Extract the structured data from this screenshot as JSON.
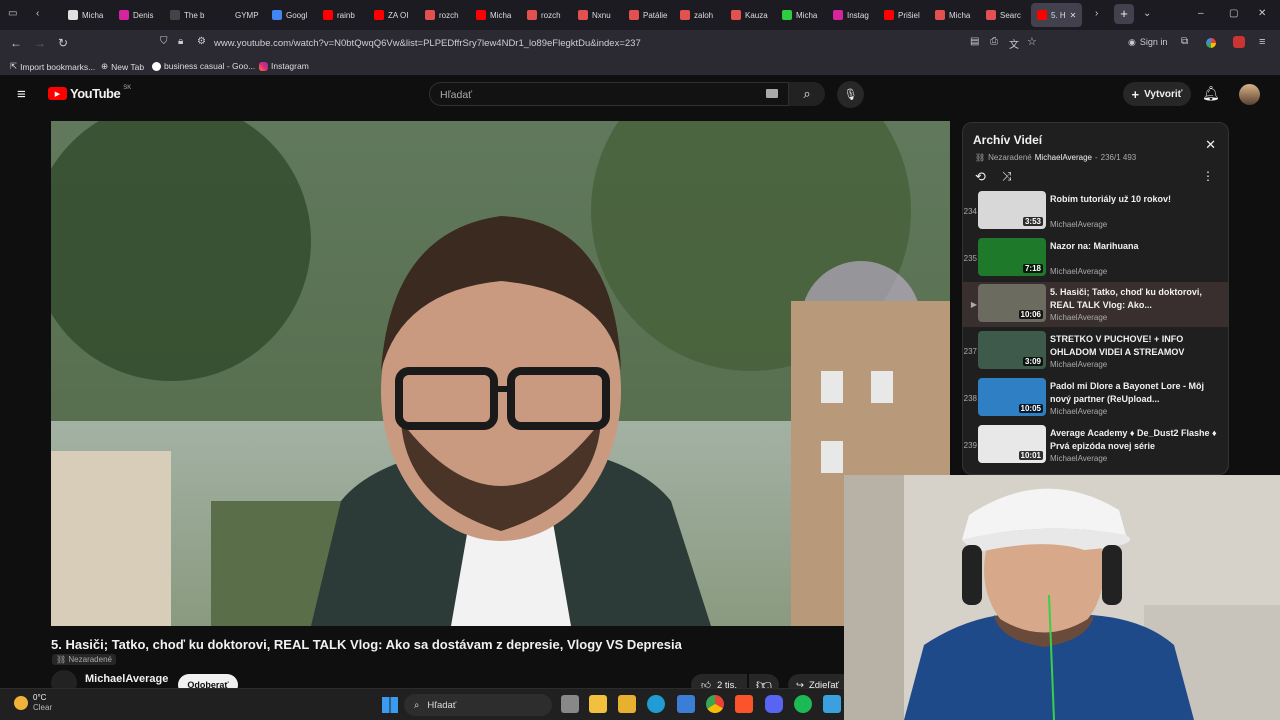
{
  "browser": {
    "tabs": [
      {
        "label": "Micha",
        "color": "#e0e0e0"
      },
      {
        "label": "Denis",
        "color": "#d6249f"
      },
      {
        "label": "The b",
        "color": "#444444"
      },
      {
        "label": "GYMP",
        "color": "#1c1b22"
      },
      {
        "label": "Googl",
        "color": "#4285f4"
      },
      {
        "label": "rainb",
        "color": "#ff0000"
      },
      {
        "label": "ZA OI",
        "color": "#ff0000"
      },
      {
        "label": "rozch",
        "color": "#e25050"
      },
      {
        "label": "Micha",
        "color": "#ff0000"
      },
      {
        "label": "rozch",
        "color": "#e25050"
      },
      {
        "label": "Nxnu",
        "color": "#e25050"
      },
      {
        "label": "Patálie",
        "color": "#e25050"
      },
      {
        "label": "zaloh",
        "color": "#e25050"
      },
      {
        "label": "Kauza",
        "color": "#e25050"
      },
      {
        "label": "Micha",
        "color": "#2ecc40"
      },
      {
        "label": "Instag",
        "color": "#d6249f"
      },
      {
        "label": "Prišiel",
        "color": "#ff0000"
      },
      {
        "label": "Micha",
        "color": "#e25050"
      },
      {
        "label": "Searc",
        "color": "#e25050"
      },
      {
        "label": "5. H",
        "color": "#ff0000"
      }
    ],
    "url": "www.youtube.com/watch?v=N0btQwqQ6Vw&list=PLPEDffrSry7lew4NDr1_lo89eFlegktDu&index=237",
    "sign_in": "Sign in",
    "bookmarks": [
      "Import bookmarks...",
      "New Tab",
      "business casual - Goo...",
      "Instagram"
    ]
  },
  "youtube": {
    "logo_text": "YouTube",
    "region": "SK",
    "search_placeholder": "Hľadať",
    "create_label": "Vytvoriť",
    "video_title": "5. Hasiči; Tatko, choď ku doktorovi, REAL TALK Vlog: Ako sa dostávam z depresie, Vlogy VS Depresia",
    "visibility": "Nezaradené",
    "channel_name": "MichaelAverage",
    "subscribe_label": "Odoberať",
    "likes": "2 tis.",
    "share_label": "Zdieľať"
  },
  "playlist": {
    "title": "Archív Videí",
    "visibility": "Nezaradené",
    "owner": "MichaelAverage",
    "position": "236/1 493",
    "items": [
      {
        "index": "234",
        "title": "Robím tutoriály už 10 rokov!",
        "channel": "MichaelAverage",
        "duration": "3:53",
        "thumb_color": "#d8d8d8",
        "active": false
      },
      {
        "index": "235",
        "title": "Nazor na: Marihuana",
        "channel": "MichaelAverage",
        "duration": "7:18",
        "thumb_color": "#1e7a2a",
        "active": false
      },
      {
        "index": "",
        "title": "5. Hasiči; Tatko, choď ku doktorovi, REAL TALK Vlog: Ako...",
        "channel": "MichaelAverage",
        "duration": "10:06",
        "thumb_color": "#6b6b60",
        "active": true
      },
      {
        "index": "237",
        "title": "STRETKO V PUCHOVE! + INFO OHLADOM VIDEI A STREAMOV",
        "channel": "MichaelAverage",
        "duration": "3:09",
        "thumb_color": "#3d5a4a",
        "active": false
      },
      {
        "index": "238",
        "title": "Padol mi Dlore a Bayonet Lore - Môj nový partner (ReUpload...",
        "channel": "MichaelAverage",
        "duration": "10:05",
        "thumb_color": "#2f7fc4",
        "active": false
      },
      {
        "index": "239",
        "title": "Average Academy ♦ De_Dust2 Flashe ♦ Prvá epizóda novej série",
        "channel": "MichaelAverage",
        "duration": "10:01",
        "thumb_color": "#e8e8e8",
        "active": false
      }
    ]
  },
  "taskbar": {
    "weather_temp": "0°C",
    "weather_text": "Clear",
    "search_label": "Hľadať"
  }
}
